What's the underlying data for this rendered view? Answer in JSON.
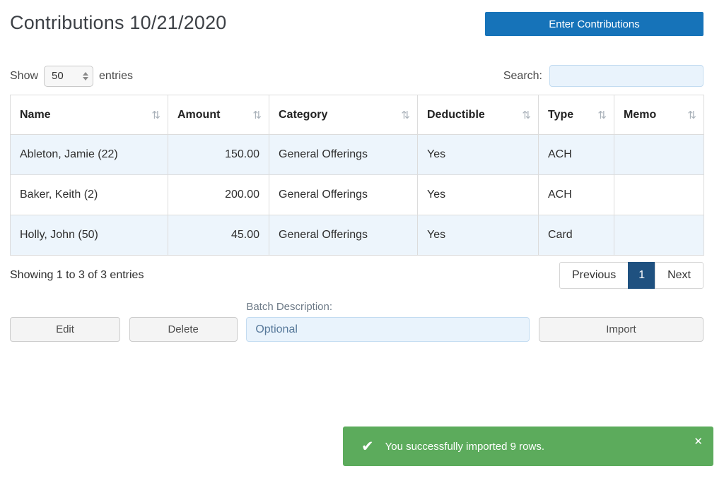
{
  "page": {
    "title": "Contributions 10/21/2020",
    "enter_contributions_label": "Enter Contributions"
  },
  "controls": {
    "show_label": "Show",
    "entries_label": "entries",
    "page_length": "50",
    "search_label": "Search:",
    "search_value": ""
  },
  "table": {
    "columns": [
      "Name",
      "Amount",
      "Category",
      "Deductible",
      "Type",
      "Memo"
    ],
    "rows": [
      {
        "name": "Ableton, Jamie (22)",
        "amount": "150.00",
        "category": "General Offerings",
        "deductible": "Yes",
        "type": "ACH",
        "memo": ""
      },
      {
        "name": "Baker, Keith (2)",
        "amount": "200.00",
        "category": "General Offerings",
        "deductible": "Yes",
        "type": "ACH",
        "memo": ""
      },
      {
        "name": "Holly, John (50)",
        "amount": "45.00",
        "category": "General Offerings",
        "deductible": "Yes",
        "type": "Card",
        "memo": ""
      }
    ]
  },
  "footer": {
    "showing_text": "Showing 1 to 3 of 3 entries",
    "previous_label": "Previous",
    "current_page": "1",
    "next_label": "Next"
  },
  "actions": {
    "edit_label": "Edit",
    "delete_label": "Delete",
    "batch_description_label": "Batch Description:",
    "batch_description_placeholder": "Optional",
    "import_label": "Import"
  },
  "toast": {
    "message": "You successfully imported 9 rows."
  },
  "icons": {
    "sort": "⇅",
    "check": "✔",
    "close": "✕"
  },
  "colors": {
    "primary_blue": "#1673b9",
    "active_page_blue": "#1f5180",
    "toast_green": "#5cab5c",
    "stripe_blue": "#edf5fc",
    "input_blue_bg": "#e9f3fc",
    "input_blue_border": "#c3dcf1"
  }
}
